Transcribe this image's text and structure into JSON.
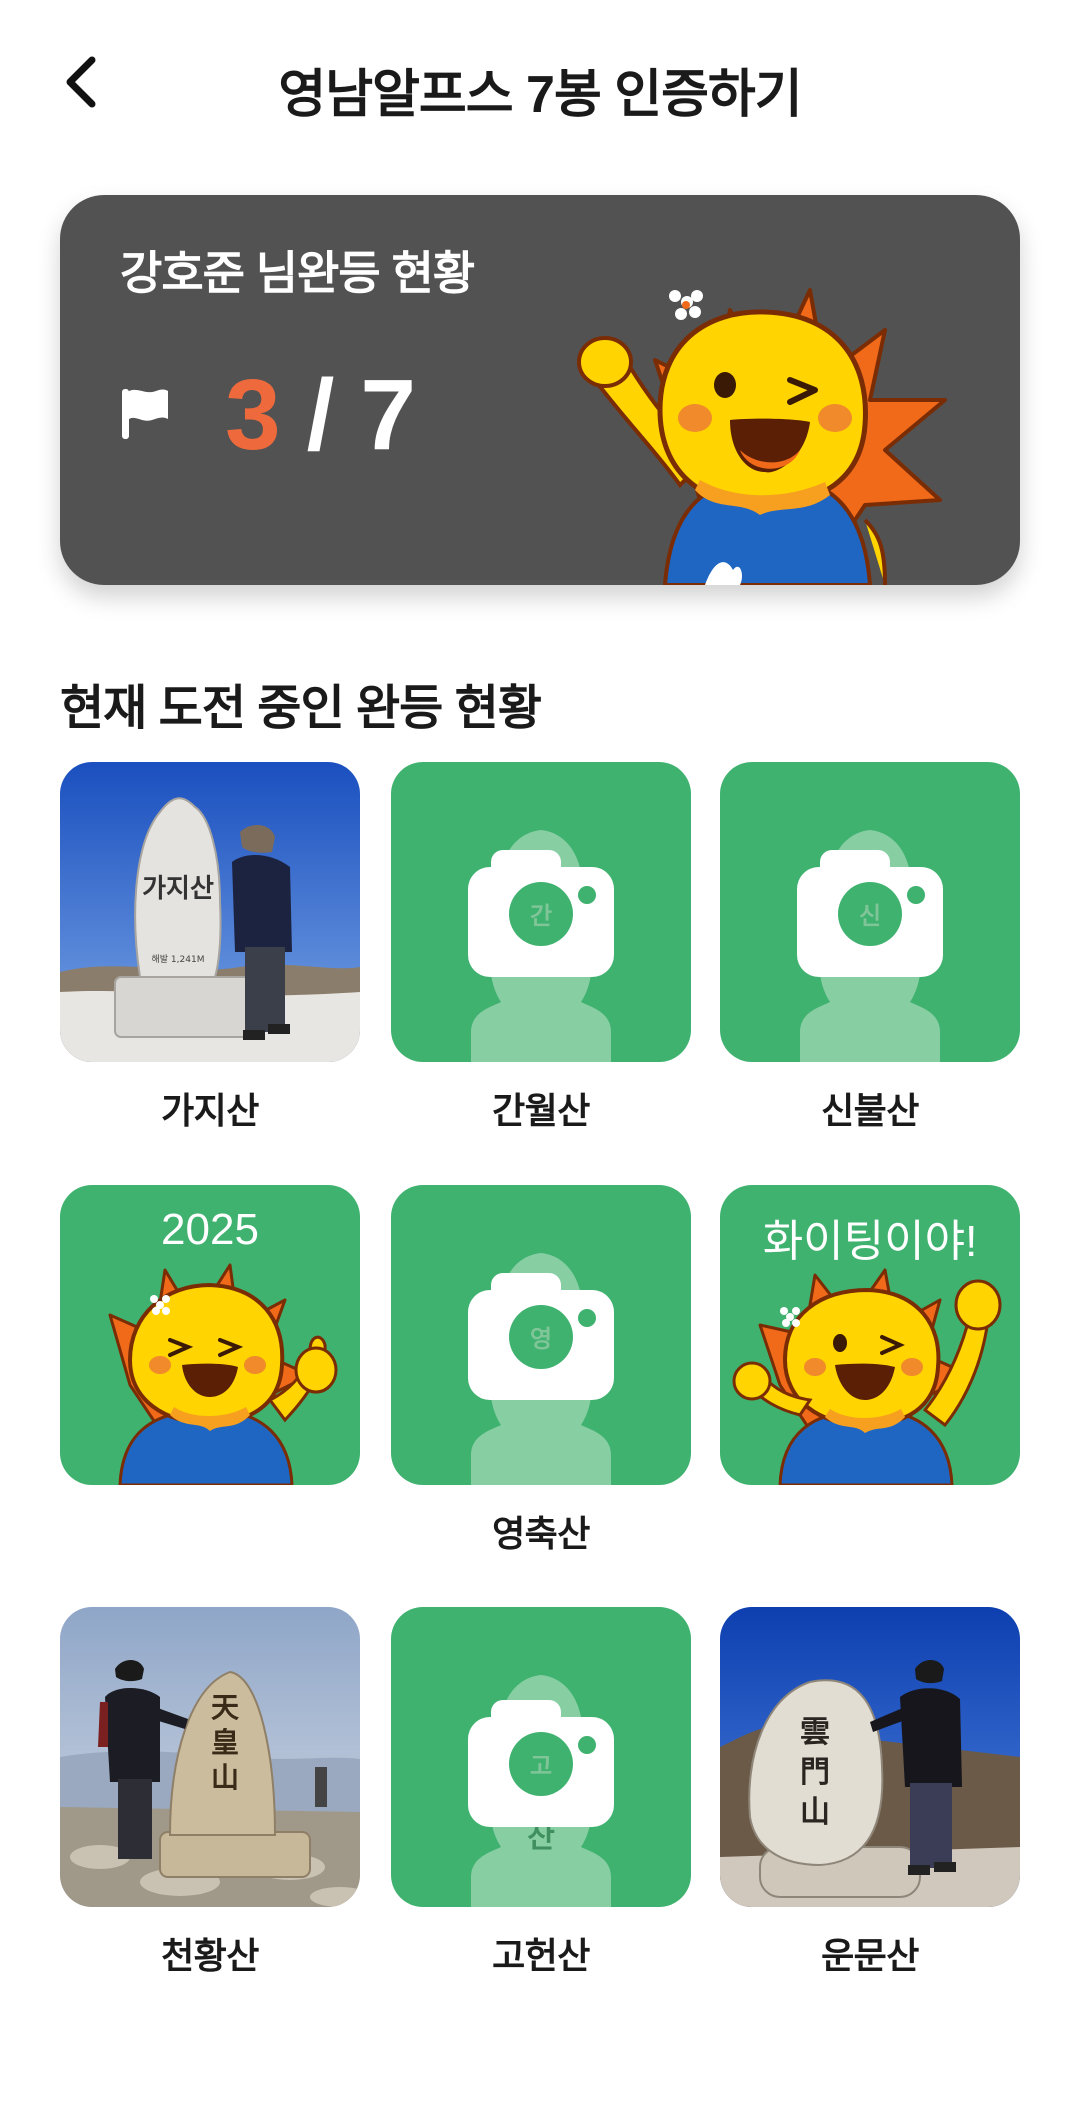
{
  "header": {
    "back_icon": "chevron-left-icon",
    "title": "영남알프스 7봉 인증하기"
  },
  "status": {
    "title": "강호준 님완등 현황",
    "flag_icon": "flag-icon",
    "completed": "3",
    "separator": "/",
    "total": "7",
    "colors": {
      "card": "#525252",
      "completed": "#ee6a3c"
    }
  },
  "section": {
    "title": "현재 도전 중인 완등 현황"
  },
  "mountains": [
    {
      "label": "가지산",
      "state": "certified-photo",
      "stone_text": "가지산",
      "stone_sub": "해발 1,241M"
    },
    {
      "label": "간월산",
      "state": "camera-placeholder",
      "stone_text": "간월산"
    },
    {
      "label": "신불산",
      "state": "camera-placeholder",
      "stone_text": "신불산"
    },
    {
      "label": "",
      "state": "mascot-thumbsup",
      "banner": "2025"
    },
    {
      "label": "영축산",
      "state": "camera-placeholder",
      "stone_text": "영축산"
    },
    {
      "label": "",
      "state": "mascot-cheer",
      "banner": "화이팅이야!"
    },
    {
      "label": "천황산",
      "state": "certified-photo",
      "stone_text": "天皇山"
    },
    {
      "label": "고헌산",
      "state": "camera-placeholder",
      "stone_text": "고헌산"
    },
    {
      "label": "운문산",
      "state": "certified-photo",
      "stone_text": "雲門山"
    }
  ],
  "colors": {
    "tile_green": "#3fb26f",
    "mascot_body": "#ffd400",
    "mascot_rays": "#f06a1a",
    "mascot_shirt": "#1f66c2"
  }
}
